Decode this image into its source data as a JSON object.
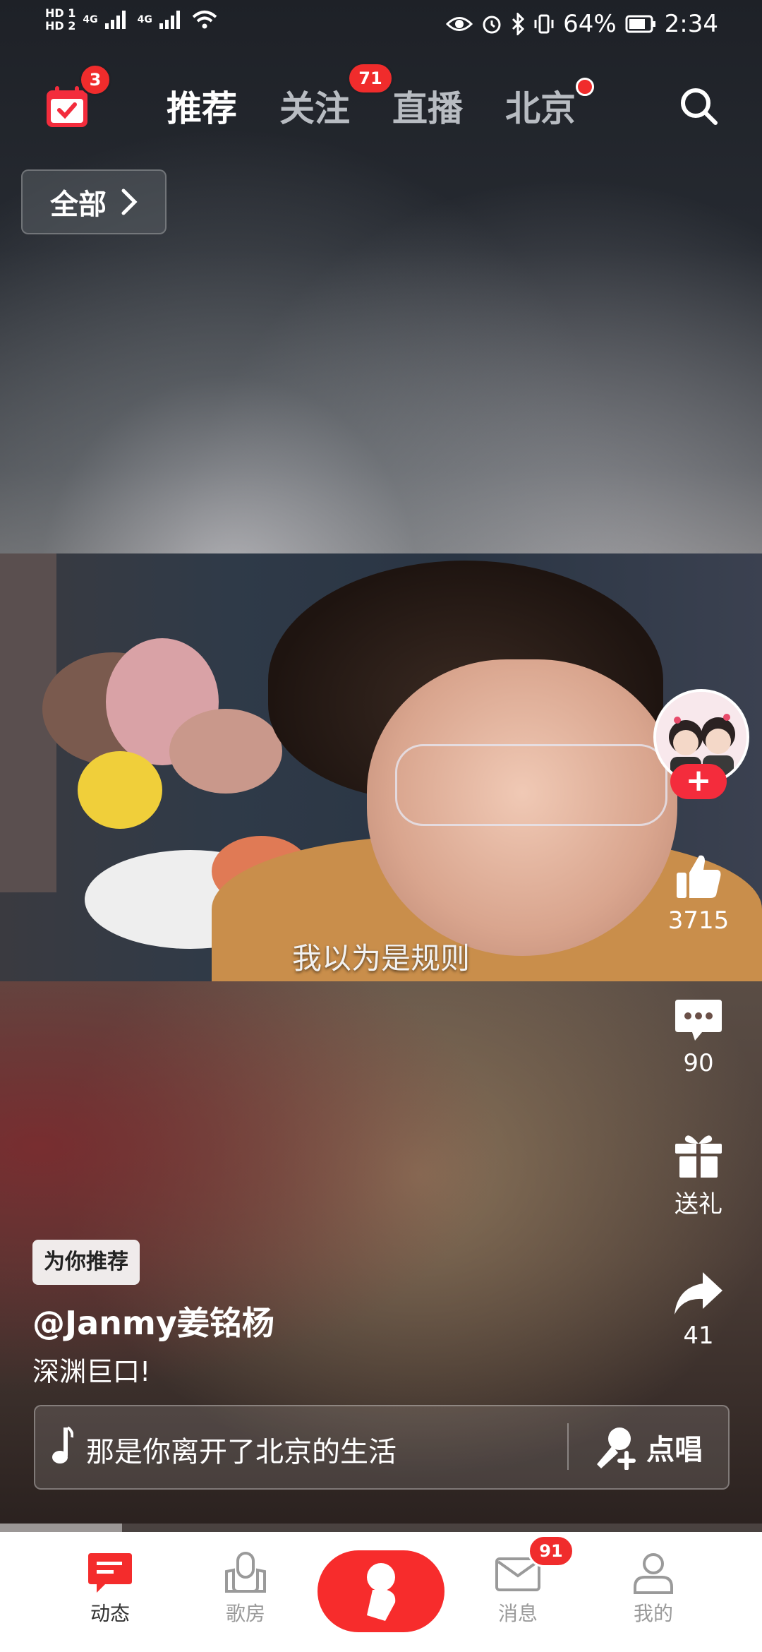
{
  "status_bar": {
    "hd1": "HD 1",
    "hd2": "HD 2",
    "net1": "4G",
    "net2": "4G",
    "battery": "64%",
    "time": "2:34"
  },
  "top_nav": {
    "calendar_badge": "3",
    "tabs": [
      {
        "label": "推荐",
        "active": true
      },
      {
        "label": "关注",
        "badge": "71"
      },
      {
        "label": "直播"
      },
      {
        "label": "北京",
        "dot": true
      }
    ],
    "filter_label": "全部"
  },
  "video": {
    "subtitle": "我以为是规则"
  },
  "rail": {
    "likes": "3715",
    "comments": "90",
    "gift_label": "送礼",
    "shares": "41"
  },
  "caption": {
    "tag": "为你推荐",
    "author": "@Janmy姜铭杨",
    "description": "深渊巨口!",
    "song": "那是你离开了北京的生活",
    "sing_label": "点唱"
  },
  "playback": {
    "progress": 0.16
  },
  "bottom_nav": {
    "items": [
      {
        "label": "动态",
        "active": true
      },
      {
        "label": "歌房"
      },
      {
        "label": "消息",
        "badge": "91"
      },
      {
        "label": "我的"
      }
    ]
  },
  "colors": {
    "accent": "#f42c2c",
    "nav_bg": "#ffffff"
  }
}
